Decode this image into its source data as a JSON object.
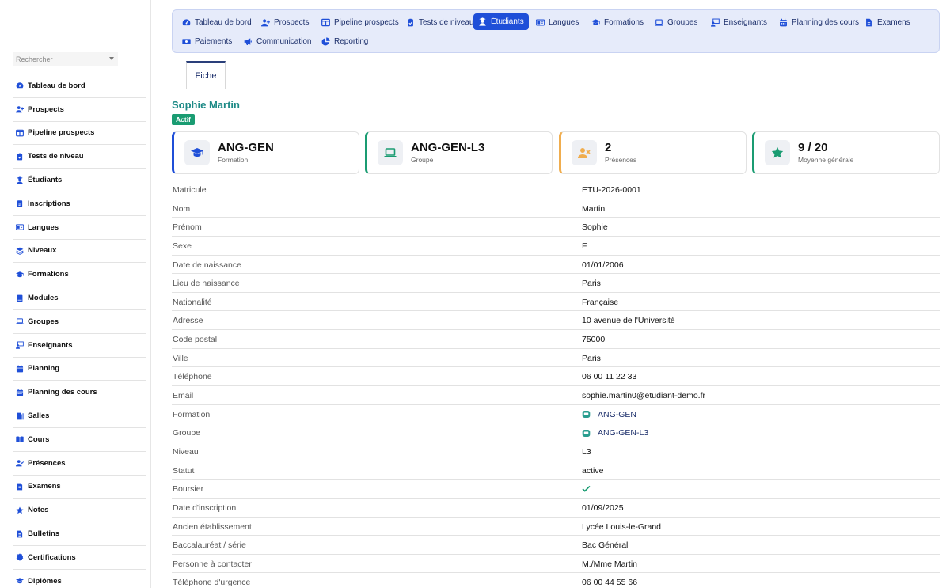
{
  "sidebar": {
    "search_placeholder": "Rechercher",
    "items": [
      {
        "label": "Tableau de bord",
        "icon": "gauge-icon"
      },
      {
        "label": "Prospects",
        "icon": "user-plus-icon"
      },
      {
        "label": "Pipeline prospects",
        "icon": "columns-icon"
      },
      {
        "label": "Tests de niveau",
        "icon": "clipboard-check-icon"
      },
      {
        "label": "Étudiants",
        "icon": "student-icon"
      },
      {
        "label": "Inscriptions",
        "icon": "clipboard-list-icon"
      },
      {
        "label": "Langues",
        "icon": "language-icon"
      },
      {
        "label": "Niveaux",
        "icon": "layers-icon"
      },
      {
        "label": "Formations",
        "icon": "graduation-cap-icon"
      },
      {
        "label": "Modules",
        "icon": "book-icon"
      },
      {
        "label": "Groupes",
        "icon": "laptop-icon"
      },
      {
        "label": "Enseignants",
        "icon": "teacher-icon"
      },
      {
        "label": "Planning",
        "icon": "calendar-icon"
      },
      {
        "label": "Planning des cours",
        "icon": "calendar-days-icon"
      },
      {
        "label": "Salles",
        "icon": "door-icon"
      },
      {
        "label": "Cours",
        "icon": "book-open-icon"
      },
      {
        "label": "Présences",
        "icon": "user-check-icon"
      },
      {
        "label": "Examens",
        "icon": "file-icon"
      },
      {
        "label": "Notes",
        "icon": "star-icon"
      },
      {
        "label": "Bulletins",
        "icon": "file-lines-icon"
      },
      {
        "label": "Certifications",
        "icon": "certificate-icon"
      },
      {
        "label": "Diplômes",
        "icon": "diploma-icon"
      }
    ]
  },
  "topnav": {
    "items": [
      {
        "label": "Tableau de bord",
        "icon": "gauge-icon"
      },
      {
        "label": "Prospects",
        "icon": "user-plus-icon"
      },
      {
        "label": "Pipeline prospects",
        "icon": "columns-icon"
      },
      {
        "label": "Tests de niveau",
        "icon": "clipboard-check-icon"
      },
      {
        "label": "Étudiants",
        "icon": "student-icon",
        "active": true
      },
      {
        "label": "Langues",
        "icon": "language-icon"
      },
      {
        "label": "Formations",
        "icon": "graduation-cap-icon"
      },
      {
        "label": "Groupes",
        "icon": "laptop-icon"
      },
      {
        "label": "Enseignants",
        "icon": "teacher-icon"
      },
      {
        "label": "Planning des cours",
        "icon": "calendar-days-icon"
      },
      {
        "label": "Examens",
        "icon": "file-icon"
      },
      {
        "label": "Paiements",
        "icon": "money-icon"
      },
      {
        "label": "Communication",
        "icon": "bullhorn-icon"
      },
      {
        "label": "Reporting",
        "icon": "chart-pie-icon"
      }
    ]
  },
  "tabs": {
    "fiche": "Fiche"
  },
  "student": {
    "name": "Sophie Martin",
    "status_badge": "Actif"
  },
  "cards": [
    {
      "value": "ANG-GEN",
      "label": "Formation",
      "icon": "graduation-cap-icon",
      "accent": "#1f4fd8"
    },
    {
      "value": "ANG-GEN-L3",
      "label": "Groupe",
      "icon": "laptop-icon",
      "accent": "#1a9c72"
    },
    {
      "value": "2",
      "label": "Présences",
      "icon": "user-xmark-icon",
      "accent": "#f0ad4e"
    },
    {
      "value": "9 / 20",
      "label": "Moyenne générale",
      "icon": "star-icon",
      "accent": "#1a9c72"
    }
  ],
  "details": [
    {
      "key": "Matricule",
      "value": "ETU-2026-0001"
    },
    {
      "key": "Nom",
      "value": "Martin"
    },
    {
      "key": "Prénom",
      "value": "Sophie"
    },
    {
      "key": "Sexe",
      "value": "F"
    },
    {
      "key": "Date de naissance",
      "value": "01/01/2006"
    },
    {
      "key": "Lieu de naissance",
      "value": "Paris"
    },
    {
      "key": "Nationalité",
      "value": "Française"
    },
    {
      "key": "Adresse",
      "value": "10 avenue de l'Université"
    },
    {
      "key": "Code postal",
      "value": "75000"
    },
    {
      "key": "Ville",
      "value": "Paris"
    },
    {
      "key": "Téléphone",
      "value": "06 00 11 22 33"
    },
    {
      "key": "Email",
      "value": "sophie.martin0@etudiant-demo.fr"
    },
    {
      "key": "Formation",
      "value": "ANG-GEN",
      "link": true,
      "icon": "record-icon"
    },
    {
      "key": "Groupe",
      "value": "ANG-GEN-L3",
      "link": true,
      "icon": "record-icon"
    },
    {
      "key": "Niveau",
      "value": "L3"
    },
    {
      "key": "Statut",
      "value": "active"
    },
    {
      "key": "Boursier",
      "value": "",
      "icon": "check-icon"
    },
    {
      "key": "Date d'inscription",
      "value": "01/09/2025"
    },
    {
      "key": "Ancien établissement",
      "value": "Lycée Louis-le-Grand"
    },
    {
      "key": "Baccalauréat / série",
      "value": "Bac Général"
    },
    {
      "key": "Personne à contacter",
      "value": "M./Mme Martin"
    },
    {
      "key": "Téléphone d'urgence",
      "value": "06 00 44 55 66"
    }
  ],
  "colors": {
    "primary": "#1f4fd8",
    "nav_text": "#1c2f6b",
    "teal": "#1d8a86",
    "success": "#1a9c72",
    "warning": "#f0ad4e"
  }
}
